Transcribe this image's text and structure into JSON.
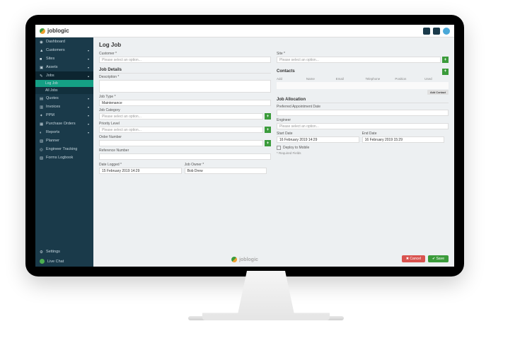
{
  "brand": "joblogic",
  "sidebar": {
    "items": [
      {
        "label": "Dashboard"
      },
      {
        "label": "Customers"
      },
      {
        "label": "Sites"
      },
      {
        "label": "Assets"
      },
      {
        "label": "Jobs"
      },
      {
        "label": "Quotes"
      },
      {
        "label": "Invoices"
      },
      {
        "label": "PPM"
      },
      {
        "label": "Purchase Orders"
      },
      {
        "label": "Reports"
      },
      {
        "label": "Planner"
      },
      {
        "label": "Engineer Tracking"
      },
      {
        "label": "Forms Logbook"
      }
    ],
    "subitems": [
      {
        "label": "Log Job"
      },
      {
        "label": "All Jobs"
      }
    ],
    "settings": "Settings",
    "livechat": "Live Chat"
  },
  "page": {
    "title": "Log Job",
    "customer_label": "Customer *",
    "customer_placeholder": "Please select an option...",
    "site_label": "Site *",
    "site_placeholder": "Please select an option...",
    "job_details": "Job Details",
    "description_label": "Description *",
    "job_type_label": "Job Type *",
    "job_type_value": "Maintenance",
    "job_category_label": "Job Category",
    "job_category_placeholder": "Please select an option...",
    "priority_label": "Priority Level",
    "priority_placeholder": "Please select an option...",
    "order_number_label": "Order Number",
    "reference_label": "Reference Number",
    "date_logged_label": "Date Logged *",
    "date_logged_value": "15 February 2019 14:29",
    "job_owner_label": "Job Owner *",
    "job_owner_value": "Bob Drew",
    "contacts": "Contacts",
    "contacts_cols": {
      "add": "Add",
      "name": "Name",
      "email": "Email",
      "telephone": "Telephone",
      "position": "Position",
      "used": "Used"
    },
    "add_contact": "Add Contact",
    "allocation": "Job Allocation",
    "preferred_date_label": "Preferred Appointment Date",
    "engineer_label": "Engineer",
    "engineer_placeholder": "Please select an option...",
    "start_date_label": "Start Date",
    "start_date_value": "16 February 2019 14:29",
    "end_date_label": "End Date",
    "end_date_value": "16 February 2019 15:29",
    "deploy_label": "Deploy to Mobile",
    "required_fields": "* Required Fields",
    "cancel": "Cancel",
    "save": "Save"
  }
}
